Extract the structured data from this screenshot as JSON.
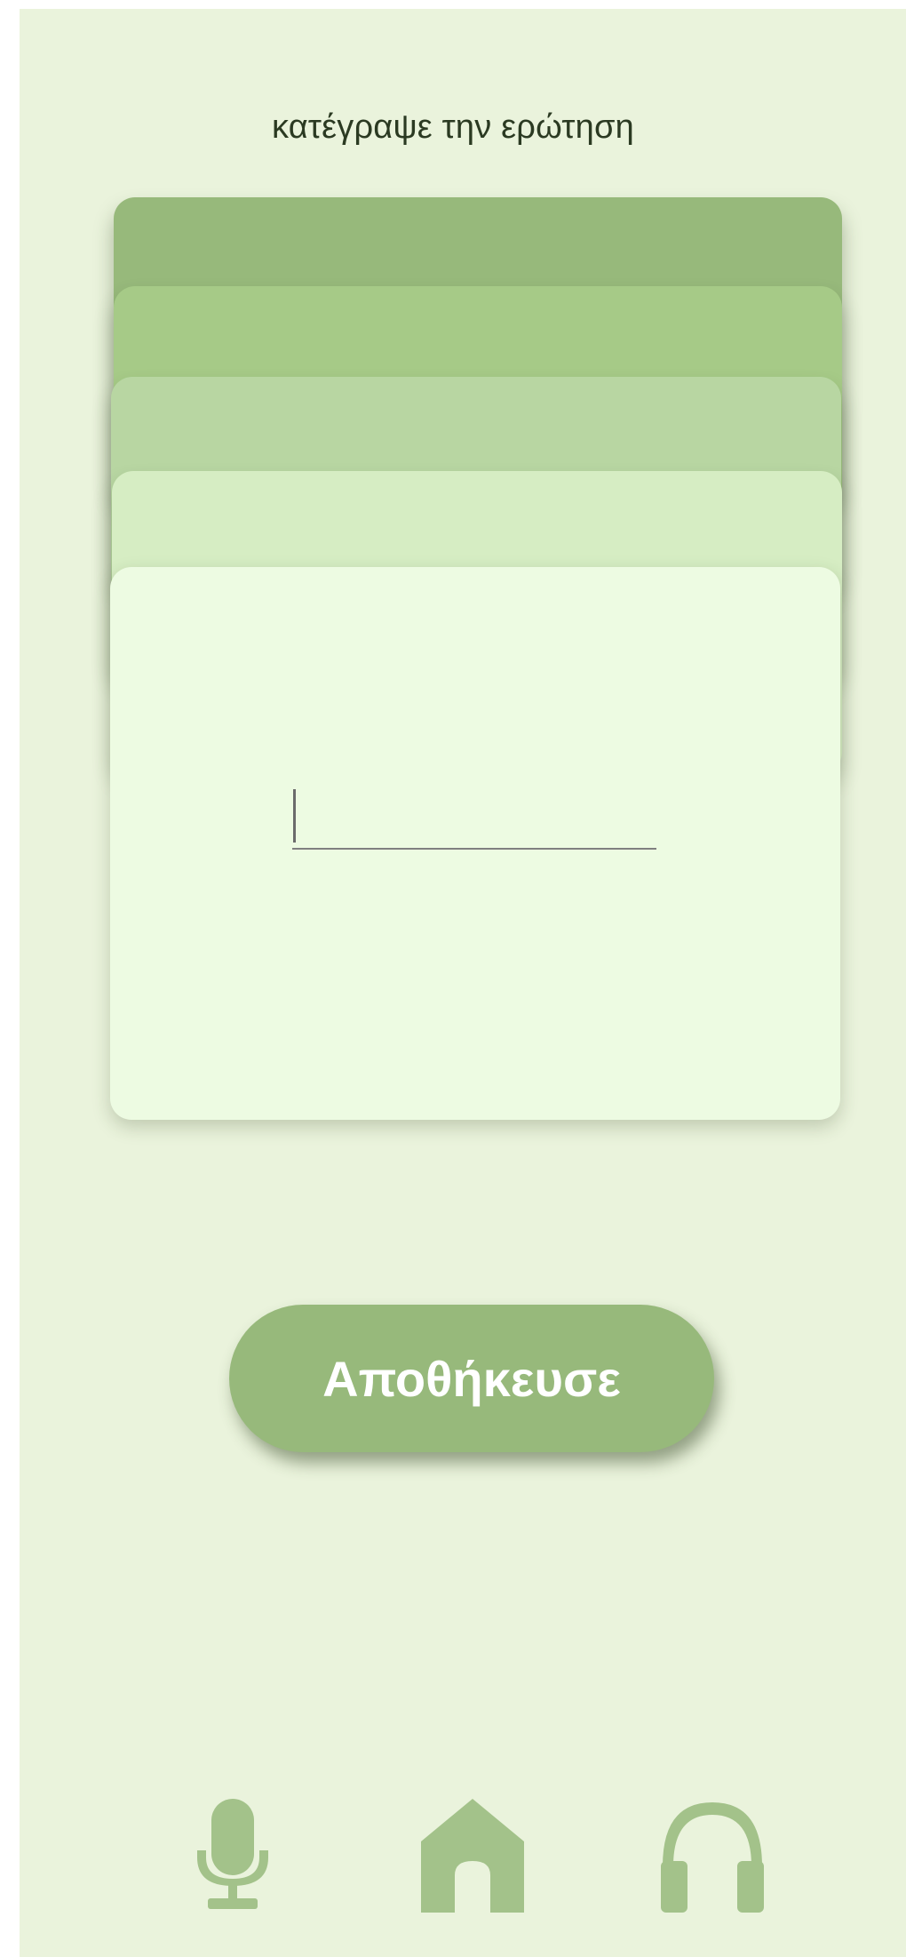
{
  "screen": {
    "title": "κατέγραψε την ερώτηση"
  },
  "question_input": {
    "value": "",
    "placeholder": ""
  },
  "save_button": {
    "label": "Αποθήκευσε"
  },
  "bottom_nav": {
    "items": [
      {
        "icon": "microphone-icon"
      },
      {
        "icon": "home-icon"
      },
      {
        "icon": "headphones-icon"
      }
    ]
  },
  "colors": {
    "background": "#eaf3dc",
    "accent": "#97b97b",
    "card_front": "#edfbe2",
    "nav_icon": "#a3c28a"
  }
}
